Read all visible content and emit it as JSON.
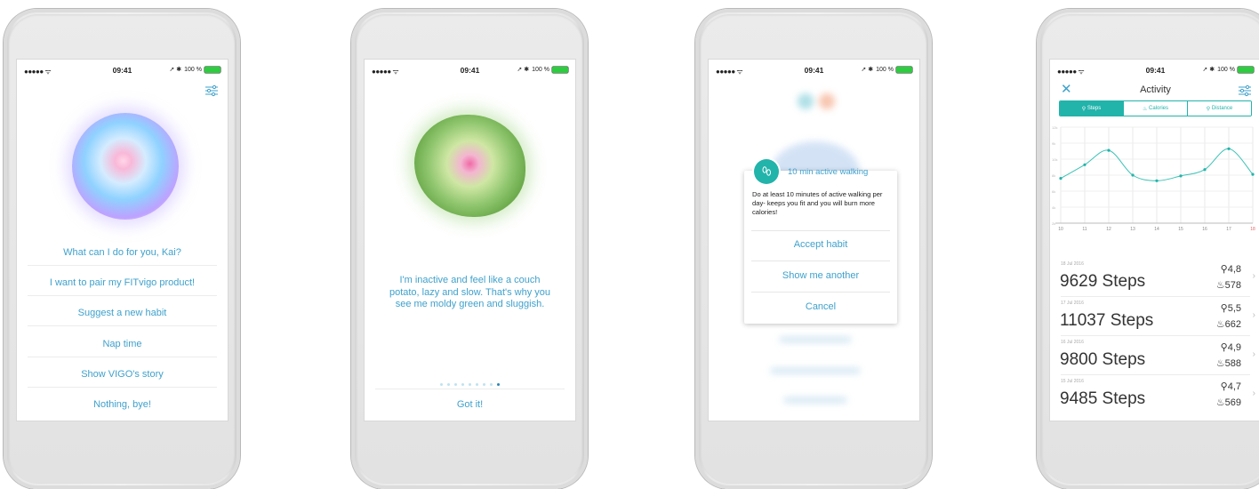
{
  "status_bar": {
    "signal": "●●●●● ᯤ",
    "time": "09:41",
    "battery": "100 %"
  },
  "phone1": {
    "prompt": "What can I do for you, Kai?",
    "menu": [
      "I want to pair my FITvigo product!",
      "Suggest a new habit",
      "Nap time",
      "Show VIGO's story",
      "Nothing, bye!"
    ]
  },
  "phone2": {
    "message": "I'm inactive and feel like a couch potato, lazy and slow. That's why you see me moldy green and sluggish.",
    "button": "Got it!"
  },
  "phone3": {
    "dialog_title": "10 min active walking",
    "dialog_text": "Do at least 10 minutes of active walking per day- keeps you fit and you will burn more calories!",
    "buttons": [
      "Accept habit",
      "Show me another",
      "Cancel"
    ]
  },
  "phone4": {
    "title": "Activity",
    "tabs": [
      "Steps",
      "Calories",
      "Distance"
    ],
    "chart_x_labels": [
      "10",
      "11",
      "12",
      "13",
      "14",
      "15",
      "16",
      "17",
      "18"
    ],
    "chart_y_labels": [
      "12k",
      "9k",
      "10k",
      "8k",
      "6k",
      "4k",
      "2k"
    ],
    "entries": [
      {
        "date": "18 Jul 2016",
        "steps": "9629 Steps",
        "distance": "4,8",
        "calories": "578"
      },
      {
        "date": "17 Jul 2016",
        "steps": "11037 Steps",
        "distance": "5,5",
        "calories": "662"
      },
      {
        "date": "16 Jul 2016",
        "steps": "9800 Steps",
        "distance": "4,9",
        "calories": "588"
      },
      {
        "date": "15 Jul 2016",
        "steps": "9485 Steps",
        "distance": "4,7",
        "calories": "569"
      }
    ]
  },
  "colors": {
    "accent": "#3ea1cc",
    "teal": "#22b3aa",
    "battery": "#2ecc40"
  },
  "chart_data": {
    "type": "line",
    "x": [
      "10",
      "11",
      "12",
      "13",
      "14",
      "15",
      "16",
      "17",
      "18"
    ],
    "series": [
      {
        "values": [
          5.6,
          7.3,
          9.1,
          6.0,
          5.3,
          5.9,
          6.7,
          9.3,
          6.1
        ]
      }
    ],
    "ylim": [
      0,
      12
    ]
  }
}
